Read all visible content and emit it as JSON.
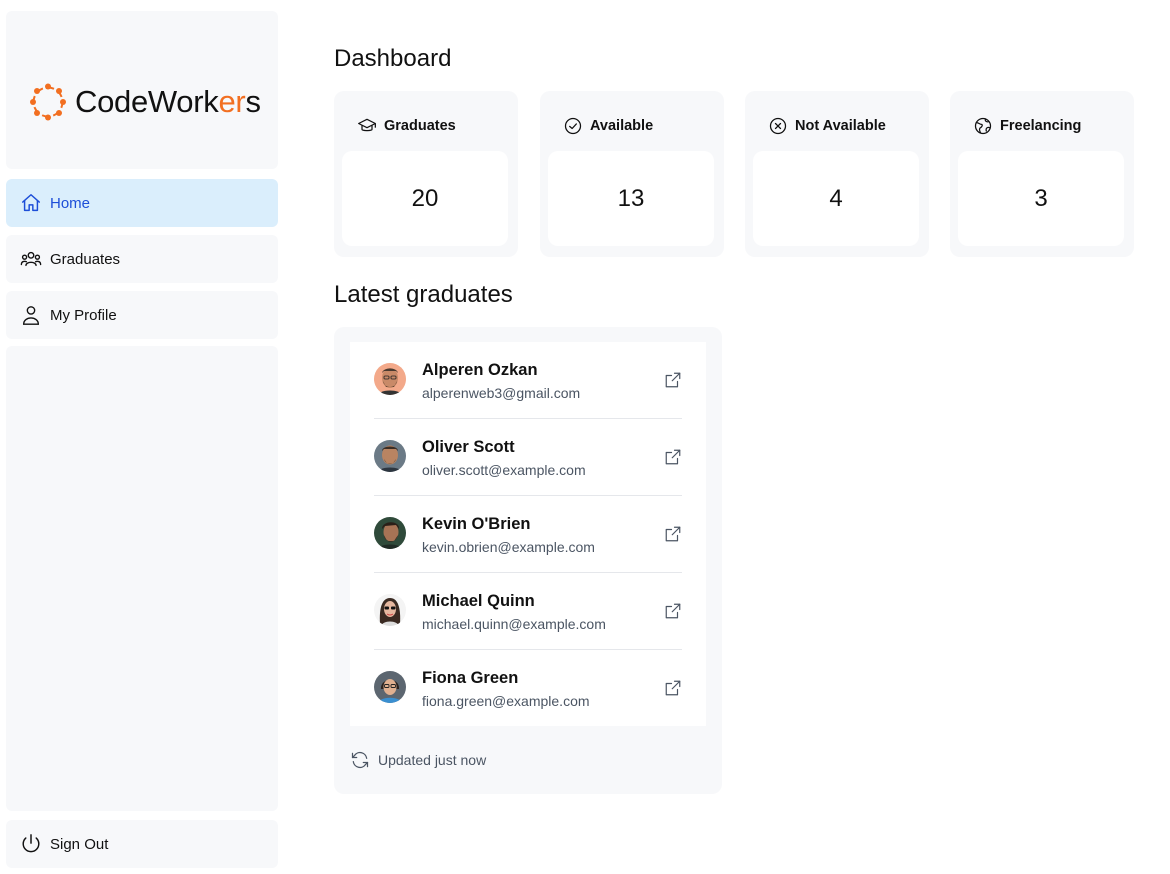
{
  "brand": {
    "name_prefix": "CodeWork",
    "name_accent": "er",
    "name_suffix": "s",
    "accent_color": "#f26f21"
  },
  "sidebar": {
    "items": [
      {
        "label": "Home",
        "icon": "home-icon",
        "active": true
      },
      {
        "label": "Graduates",
        "icon": "users-icon",
        "active": false
      },
      {
        "label": "My Profile",
        "icon": "user-icon",
        "active": false
      }
    ],
    "sign_out": {
      "label": "Sign Out",
      "icon": "power-icon"
    }
  },
  "dashboard": {
    "title": "Dashboard",
    "stats": [
      {
        "label": "Graduates",
        "value": "20",
        "icon": "graduation-cap-icon"
      },
      {
        "label": "Available",
        "value": "13",
        "icon": "check-circle-icon"
      },
      {
        "label": "Not Available",
        "value": "4",
        "icon": "x-circle-icon"
      },
      {
        "label": "Freelancing",
        "value": "3",
        "icon": "globe-icon"
      }
    ]
  },
  "latest": {
    "title": "Latest graduates",
    "graduates": [
      {
        "name": "Alperen Ozkan",
        "email": "alperenweb3@gmail.com"
      },
      {
        "name": "Oliver Scott",
        "email": "oliver.scott@example.com"
      },
      {
        "name": "Kevin O'Brien",
        "email": "kevin.obrien@example.com"
      },
      {
        "name": "Michael Quinn",
        "email": "michael.quinn@example.com"
      },
      {
        "name": "Fiona Green",
        "email": "fiona.green@example.com"
      }
    ],
    "updated_text": "Updated just now"
  },
  "colors": {
    "active_nav_bg": "#daeefc",
    "active_nav_text": "#1d4ed8",
    "panel_bg": "#f7f8fa"
  }
}
